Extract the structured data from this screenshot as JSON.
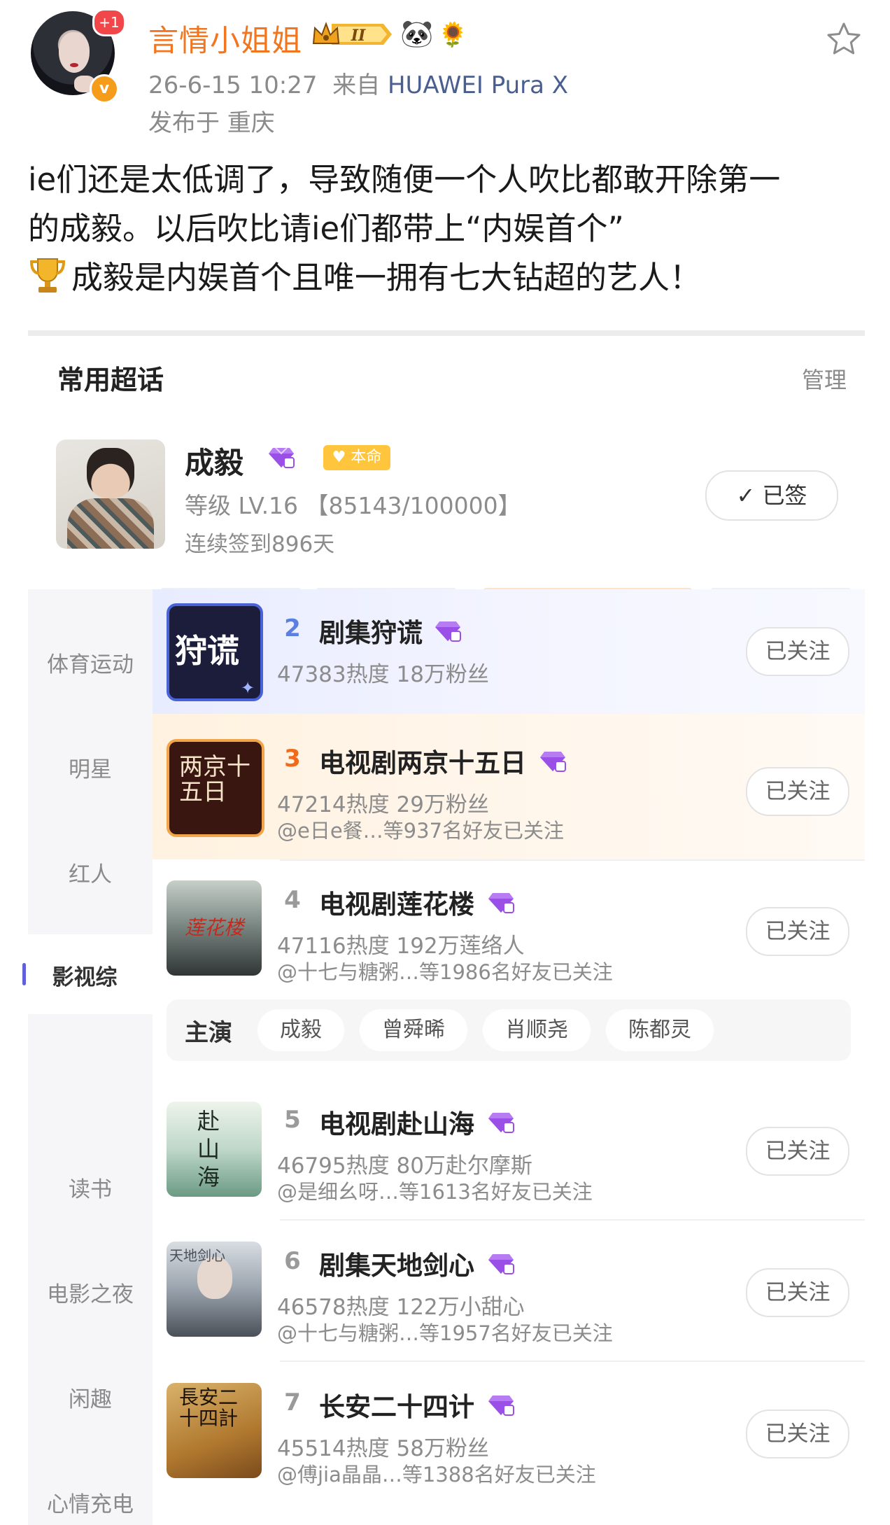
{
  "post": {
    "badge_count": "+1",
    "verified_mark": "v",
    "username": "言情小姐姐",
    "level_badge": "II",
    "emoji_1": "🐼",
    "emoji_2": "🌻",
    "date": "26-6-15 10:27",
    "from_label": "来自",
    "device": "HUAWEI Pura X",
    "location": "发布于 重庆",
    "text_lines": [
      "ie们还是太低调了，导致随便一个人吹比都敢开除第一",
      "的成毅。以后吹比请ie们都带上“内娱首个”",
      "成毅是内娱首个且唯一拥有七大钻超的艺人！"
    ],
    "icons": {
      "star": "star-outline-icon",
      "trophy": "trophy-icon",
      "crown": "crown-icon"
    }
  },
  "supertopic": {
    "section_title": "常用超话",
    "manage": "管理",
    "current": {
      "name": "成毅",
      "tag": "本命",
      "level": "等级 LV.16 【85143/100000】",
      "streak": "连续签到896天",
      "signed_label": "✓ 已签"
    },
    "sidebar": [
      "体育运动",
      "明星",
      "红人",
      "影视综",
      "读书",
      "电影之夜",
      "闲趣",
      "心情充电"
    ],
    "active_category": "影视综",
    "follow_label": "已关注",
    "items": [
      {
        "rank": "2",
        "title": "剧集狩谎",
        "stats": "47383热度 18万粉丝",
        "friends": "",
        "thumb_text": "狩谎"
      },
      {
        "rank": "3",
        "title": "电视剧两京十五日",
        "stats": "47214热度 29万粉丝",
        "friends": "@e日e餐…等937名好友已关注",
        "thumb_text": "两京十五日"
      },
      {
        "rank": "4",
        "title": "电视剧莲花楼",
        "stats": "47116热度 192万莲络人",
        "friends": "@十七与糖粥…等1986名好友已关注",
        "thumb_text": "莲花楼"
      },
      {
        "rank": "5",
        "title": "电视剧赴山海",
        "stats": "46795热度 80万赴尔摩斯",
        "friends": "@是细幺呀…等1613名好友已关注",
        "thumb_text": "赴山海"
      },
      {
        "rank": "6",
        "title": "剧集天地剑心",
        "stats": "46578热度 122万小甜心",
        "friends": "@十七与糖粥…等1957名好友已关注",
        "thumb_text": "天地剑心"
      },
      {
        "rank": "7",
        "title": "长安二十四计",
        "stats": "45514热度 58万粉丝",
        "friends": "@傅jia晶晶…等1388名好友已关注",
        "thumb_text": "長安二十四計"
      }
    ],
    "cast": {
      "label": "主演",
      "members": [
        "成毅",
        "曾舜晞",
        "肖顺尧",
        "陈都灵"
      ]
    },
    "colors": {
      "rank_2": "#5b7fe0",
      "rank_3": "#f06a1a",
      "rank_other": "#9a9a9a",
      "gem": "#a05ce8"
    }
  }
}
